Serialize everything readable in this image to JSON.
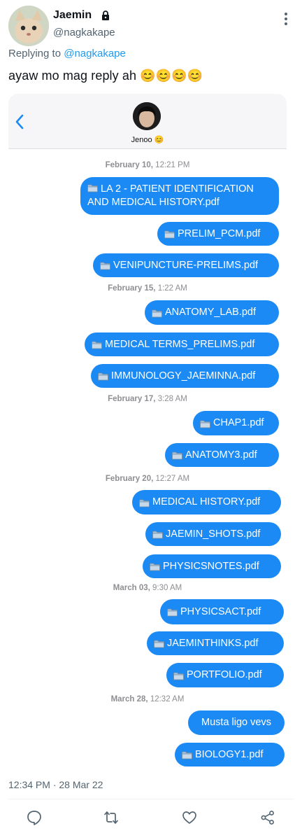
{
  "tweet": {
    "display_name": "Jaemin",
    "handle": "@nagkakape",
    "replying_prefix": "Replying to",
    "replying_to": "@nagkakape",
    "text": "ayaw mo mag reply ah 😊😊😊😊",
    "timestamp": "12:34 PM · 28 Mar 22"
  },
  "chat": {
    "contact_name": "Jenoo 😊",
    "groups": [
      {
        "date": "February 10,",
        "time": "12:21 PM",
        "messages": [
          "📁LA 2 - PATIENT IDENTIFICATION AND MEDICAL HISTORY.pdf",
          "📁PRELIM_PCM.pdf",
          "📁VENIPUNCTURE-PRELIMS.pdf"
        ]
      },
      {
        "date": "February 15,",
        "time": "1:22 AM",
        "messages": [
          "📁 ANATOMY_LAB.pdf",
          "📁 MEDICAL TERMS_PRELIMS.pdf",
          "📁IMMUNOLOGY_JAEMINNA.pdf"
        ]
      },
      {
        "date": "February 17,",
        "time": "3:28 AM",
        "messages": [
          "📁CHAP1.pdf",
          "📁 ANATOMY3.pdf"
        ]
      },
      {
        "date": "February 20,",
        "time": "12:27 AM",
        "messages": [
          "📁MEDICAL HISTORY.pdf",
          "📁JAEMIN_SHOTS.pdf",
          "📁 PHYSICSNOTES.pdf"
        ]
      },
      {
        "date": "March 03,",
        "time": "9:30 AM",
        "messages": [
          "📁 PHYSICSACT.pdf",
          "📁 JAEMINTHINKS.pdf",
          "📁 PORTFOLIO.pdf"
        ]
      },
      {
        "date": "March 28,",
        "time": "12:32 AM",
        "messages": [
          "Musta ligo vevs",
          "📁 BIOLOGY1.pdf"
        ]
      }
    ]
  },
  "actions": [
    "reply-icon",
    "retweet-icon",
    "like-icon",
    "share-icon"
  ],
  "colors": {
    "bubble": "#1b8af4",
    "link": "#1d9bf0",
    "muted": "#536471"
  }
}
